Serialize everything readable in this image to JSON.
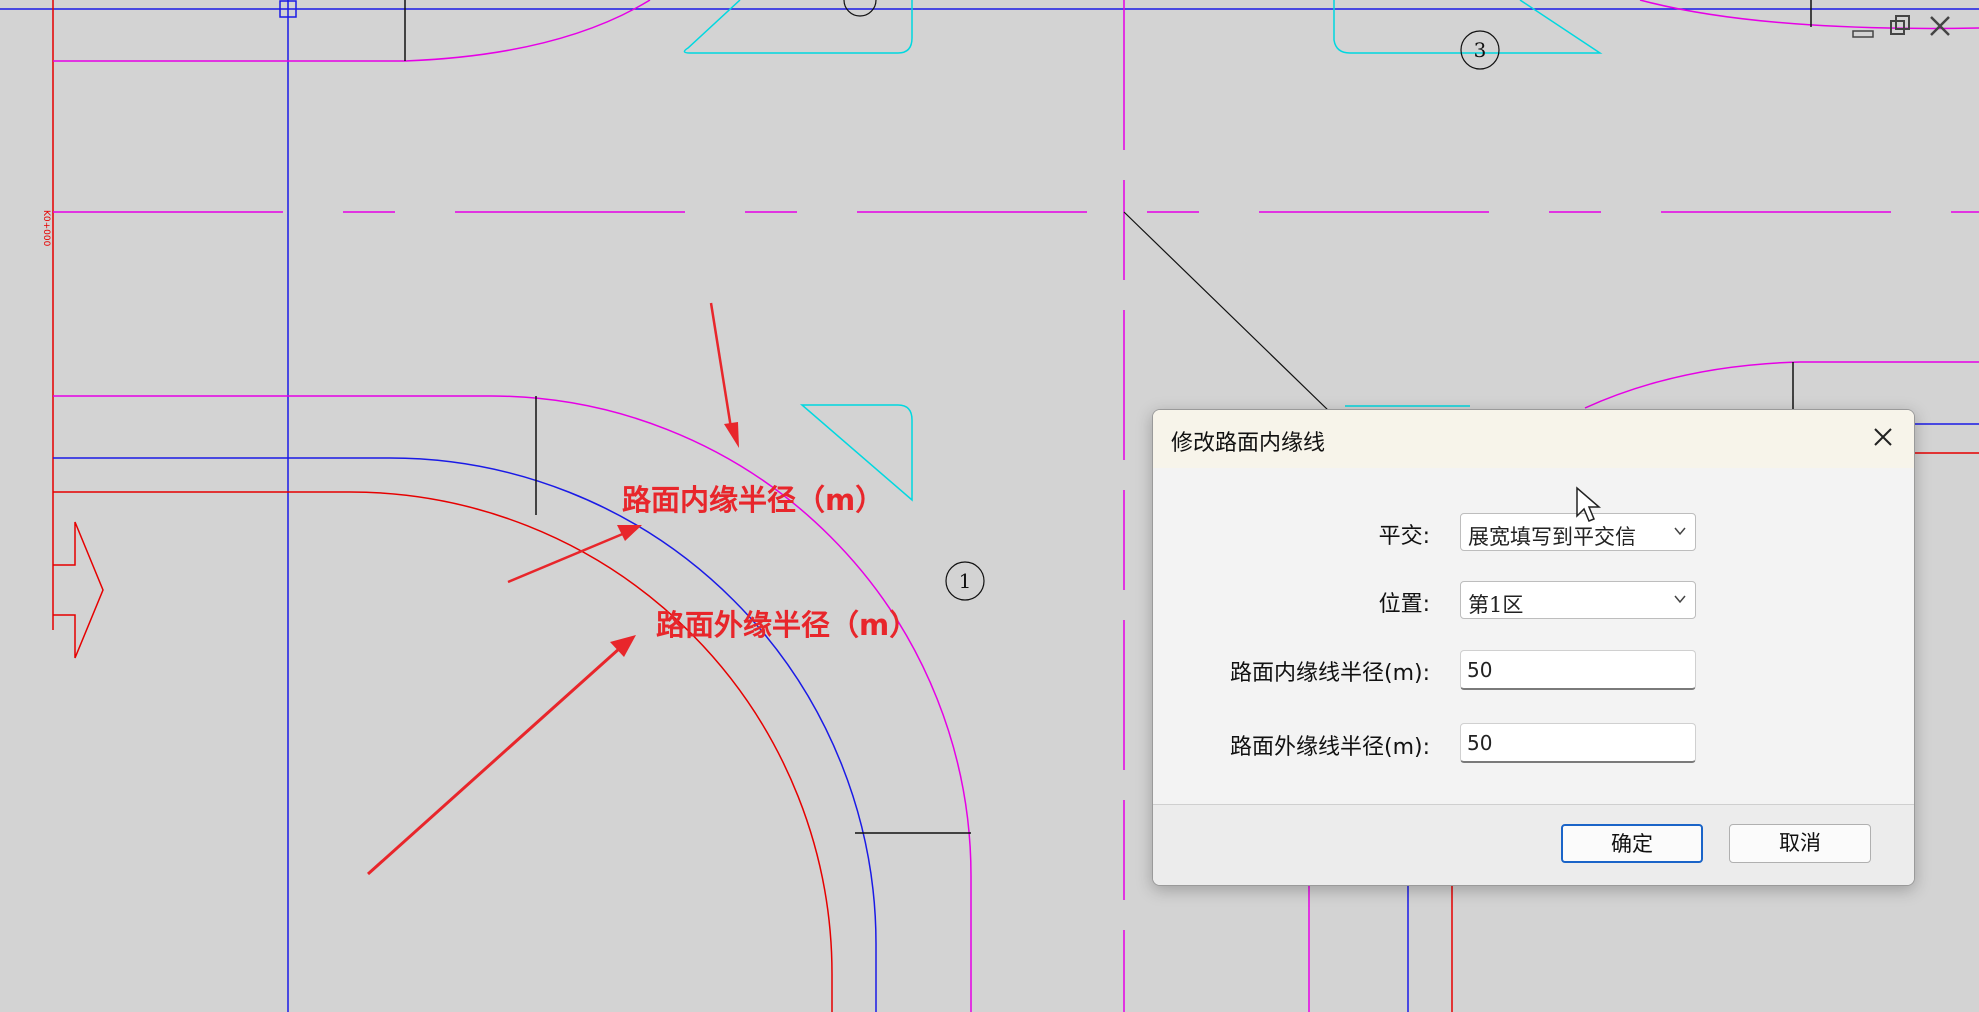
{
  "drawing": {
    "circle_labels": [
      "3",
      "1"
    ],
    "annotations": {
      "inner_radius": "路面内缘半径（m）",
      "outer_radius": "路面外缘半径（m）"
    }
  },
  "window_controls": [
    "minimize-icon",
    "restore-icon",
    "close-icon"
  ],
  "dialog": {
    "title": "修改路面内缘线",
    "fields": {
      "intersection_label": "平交:",
      "intersection_value": "展宽填写到平交信",
      "position_label": "位置:",
      "position_value": "第1区",
      "inner_radius_label": "路面内缘线半径(m):",
      "inner_radius_value": "50",
      "outer_radius_label": "路面外缘线半径(m):",
      "outer_radius_value": "50"
    },
    "ok_label": "确定",
    "cancel_label": "取消"
  },
  "colors": {
    "background": "#d3d3d3",
    "magenta": "#e600e6",
    "blue": "#1a1ae6",
    "red": "#e60000",
    "cyan": "#00d8e0",
    "annotation": "#e8262b"
  }
}
